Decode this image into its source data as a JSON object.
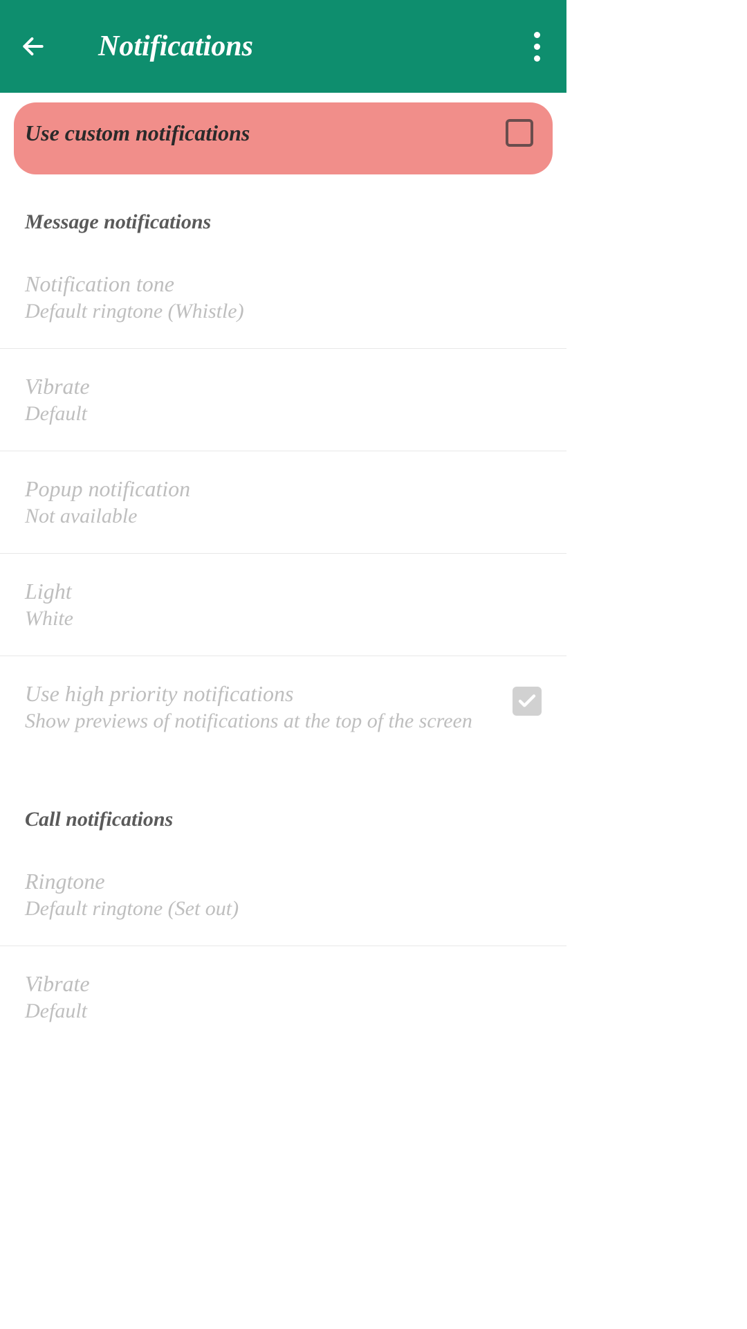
{
  "header": {
    "title": "Notifications"
  },
  "customNotifications": {
    "label": "Use custom notifications"
  },
  "messageSection": {
    "header": "Message notifications",
    "items": [
      {
        "title": "Notification tone",
        "subtitle": "Default ringtone (Whistle)"
      },
      {
        "title": "Vibrate",
        "subtitle": "Default"
      },
      {
        "title": "Popup notification",
        "subtitle": "Not available"
      },
      {
        "title": "Light",
        "subtitle": "White"
      },
      {
        "title": "Use high priority notifications",
        "subtitle": "Show previews of notifications at the top of the screen"
      }
    ]
  },
  "callSection": {
    "header": "Call notifications",
    "items": [
      {
        "title": "Ringtone",
        "subtitle": "Default ringtone (Set out)"
      },
      {
        "title": "Vibrate",
        "subtitle": "Default"
      }
    ]
  }
}
